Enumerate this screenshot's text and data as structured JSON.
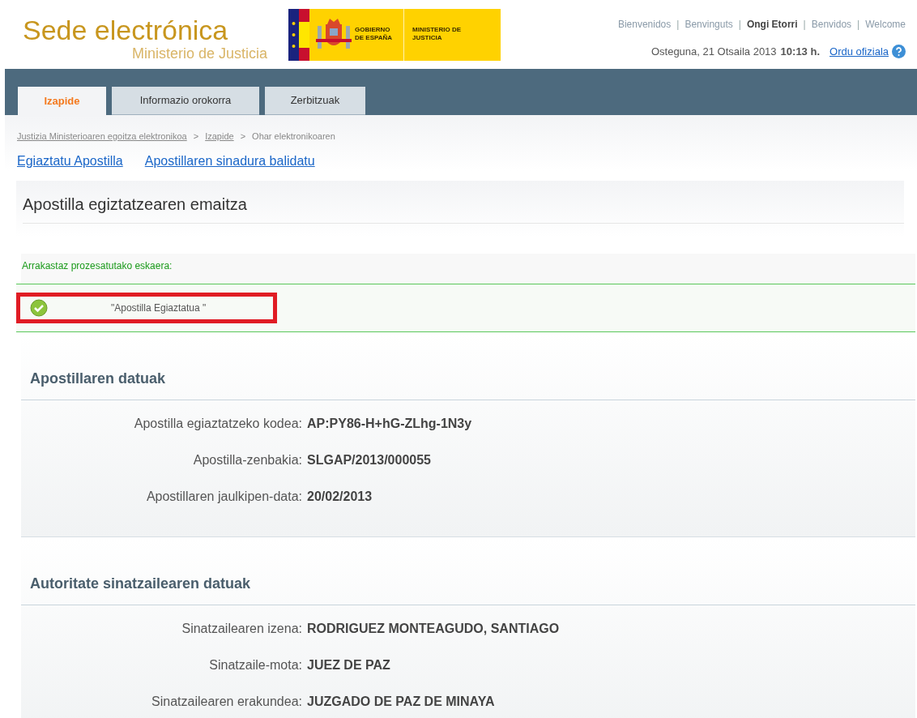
{
  "header": {
    "title": "Sede electrónica",
    "subtitle": "Ministerio de Justicia",
    "logo_texts": [
      "GOBIERNO DE ESPAÑA",
      "MINISTERIO DE JUSTICIA"
    ],
    "languages": [
      {
        "label": "Bienvenidos",
        "selected": false
      },
      {
        "label": "Benvinguts",
        "selected": false
      },
      {
        "label": "Ongi Etorri",
        "selected": true
      },
      {
        "label": "Benvidos",
        "selected": false
      },
      {
        "label": "Welcome",
        "selected": false
      }
    ],
    "language_separator": "|",
    "date": "Osteguna, 21 Otsaila 2013",
    "time": "10:13 h.",
    "official_time_link": "Ordu ofiziala"
  },
  "tabs": [
    {
      "label": "Izapide",
      "selected": true
    },
    {
      "label": "Informazio orokorra",
      "selected": false
    },
    {
      "label": "Zerbitzuak",
      "selected": false
    }
  ],
  "breadcrumb": [
    {
      "label": "Justizia Ministerioaren egoitza elektronikoa",
      "link": true
    },
    {
      "label": "Izapide",
      "link": true
    },
    {
      "label": "Ohar elektronikoaren",
      "link": false
    }
  ],
  "breadcrumb_separator": ">",
  "links": [
    "Egiaztatu Apostilla",
    "Apostillaren sinadura balidatu"
  ],
  "page_title": "Apostilla egiztatzearen emaitza",
  "result": {
    "message": "Arrakastaz prozesatutako eskaera:",
    "status": "\"Apostilla Egiaztatua \"",
    "highlighted": true
  },
  "sections": [
    {
      "title": "Apostillaren datuak",
      "fields": [
        {
          "label": "Apostilla egiaztatzeko kodea:",
          "value": "AP:PY86-H+hG-ZLhg-1N3y"
        },
        {
          "label": "Apostilla-zenbakia:",
          "value": "SLGAP/2013/000055"
        },
        {
          "label": "Apostillaren jaulkipen-data:",
          "value": "20/02/2013"
        }
      ]
    },
    {
      "title": "Autoritate sinatzailearen datuak",
      "fields": [
        {
          "label": "Sinatzailearen izena:",
          "value": "RODRIGUEZ MONTEAGUDO, SANTIAGO"
        },
        {
          "label": "Sinatzaile-mota:",
          "value": "JUEZ DE PAZ"
        },
        {
          "label": "Sinatzailearen erakundea:",
          "value": "JUZGADO DE PAZ DE MINAYA"
        }
      ]
    }
  ]
}
